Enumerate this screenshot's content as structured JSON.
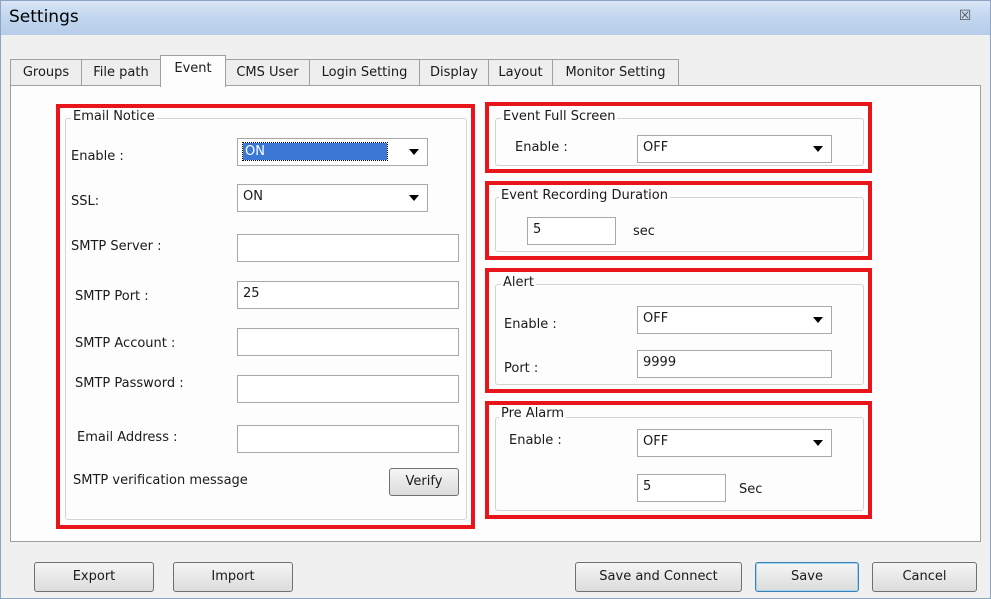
{
  "window": {
    "title": "Settings",
    "close_glyph": "☒"
  },
  "tabs": [
    "Groups",
    "File path",
    "Event",
    "CMS User",
    "Login Setting",
    "Display",
    "Layout",
    "Monitor Setting"
  ],
  "active_tab": "Event",
  "email": {
    "group_title": "Email Notice",
    "enable_label": "Enable :",
    "enable_value": "ON",
    "ssl_label": "SSL:",
    "ssl_value": "ON",
    "server_label": "SMTP Server :",
    "server_value": "",
    "port_label": "SMTP Port :",
    "port_value": "25",
    "account_label": "SMTP Account :",
    "account_value": "",
    "password_label": "SMTP Password :",
    "password_value": "",
    "address_label": "Email Address :",
    "address_value": "",
    "verify_label": "SMTP verification message",
    "verify_button": "Verify"
  },
  "full_screen": {
    "group_title": "Event Full Screen",
    "enable_label": "Enable :",
    "enable_value": "OFF"
  },
  "recording": {
    "group_title": "Event Recording Duration",
    "value": "5",
    "unit": "sec"
  },
  "alert": {
    "group_title": "Alert",
    "enable_label": "Enable :",
    "enable_value": "OFF",
    "port_label": "Port :",
    "port_value": "9999"
  },
  "pre_alarm": {
    "group_title": "Pre Alarm",
    "enable_label": "Enable :",
    "enable_value": "OFF",
    "value": "5",
    "unit": "Sec"
  },
  "footer": {
    "export": "Export",
    "import": "Import",
    "save_connect": "Save and Connect",
    "save": "Save",
    "cancel": "Cancel"
  },
  "colors": {
    "highlight_box": "#e8161b",
    "selection": "#3b78d6"
  }
}
